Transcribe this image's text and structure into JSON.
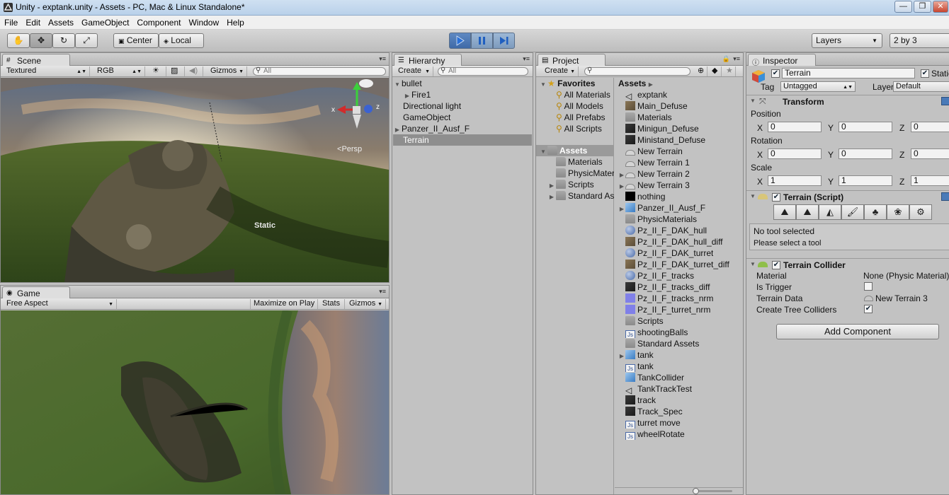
{
  "window": {
    "title": "Unity - exptank.unity - Assets - PC, Mac & Linux Standalone*"
  },
  "menu": [
    "File",
    "Edit",
    "Assets",
    "GameObject",
    "Component",
    "Window",
    "Help"
  ],
  "toolbar": {
    "pivot_label": "Center",
    "space_label": "Local",
    "layers_label": "Layers",
    "layout_label": "2 by 3"
  },
  "scene": {
    "tab": "Scene",
    "render_mode": "Textured",
    "color_mode": "RGB",
    "gizmos_label": "Gizmos",
    "search_placeholder": "All",
    "persp_label": "Persp",
    "static_label": "Static",
    "axis_x": "x",
    "axis_z": "z"
  },
  "game": {
    "tab": "Game",
    "aspect": "Free Aspect",
    "maximize_label": "Maximize on Play",
    "stats_label": "Stats",
    "gizmos_label": "Gizmos"
  },
  "hierarchy": {
    "tab": "Hierarchy",
    "create_label": "Create",
    "search_placeholder": "All",
    "items": [
      {
        "label": "bullet",
        "expanded": true,
        "depth": 0
      },
      {
        "label": "Fire1",
        "depth": 1,
        "has_children": true
      },
      {
        "label": "Directional light",
        "depth": 0
      },
      {
        "label": "GameObject",
        "depth": 0
      },
      {
        "label": "Panzer_II_Ausf_F",
        "depth": 0,
        "has_children": true
      },
      {
        "label": "Terrain",
        "depth": 0,
        "selected": true
      }
    ]
  },
  "project": {
    "tab": "Project",
    "create_label": "Create",
    "favorites_label": "Favorites",
    "favorites": [
      "All Materials",
      "All Models",
      "All Prefabs",
      "All Scripts"
    ],
    "tree_root": "Assets",
    "tree": [
      "Materials",
      "PhysicMaterials",
      "Scripts",
      "Standard Assets"
    ],
    "breadcrumb": "Assets",
    "assets": [
      {
        "name": "exptank",
        "kind": "unity"
      },
      {
        "name": "Main_Defuse",
        "kind": "texture"
      },
      {
        "name": "Materials",
        "kind": "folder"
      },
      {
        "name": "Minigun_Defuse",
        "kind": "texture-dark"
      },
      {
        "name": "Ministand_Defuse",
        "kind": "texture-dark"
      },
      {
        "name": "New Terrain",
        "kind": "terrain"
      },
      {
        "name": "New Terrain 1",
        "kind": "terrain"
      },
      {
        "name": "New Terrain 2",
        "kind": "terrain",
        "expandable": true
      },
      {
        "name": "New Terrain 3",
        "kind": "terrain",
        "expandable": true
      },
      {
        "name": "nothing",
        "kind": "black"
      },
      {
        "name": "Panzer_II_Ausf_F",
        "kind": "prefab",
        "expandable": true
      },
      {
        "name": "PhysicMaterials",
        "kind": "folder"
      },
      {
        "name": "Pz_II_F_DAK_hull",
        "kind": "sphere"
      },
      {
        "name": "Pz_II_F_DAK_hull_diff",
        "kind": "texture"
      },
      {
        "name": "Pz_II_F_DAK_turret",
        "kind": "sphere"
      },
      {
        "name": "Pz_II_F_DAK_turret_diff",
        "kind": "texture"
      },
      {
        "name": "Pz_II_F_tracks",
        "kind": "sphere"
      },
      {
        "name": "Pz_II_F_tracks_diff",
        "kind": "texture-dark"
      },
      {
        "name": "Pz_II_F_tracks_nrm",
        "kind": "normal"
      },
      {
        "name": "Pz_II_F_turret_nrm",
        "kind": "normal"
      },
      {
        "name": "Scripts",
        "kind": "folder"
      },
      {
        "name": "shootingBalls",
        "kind": "js"
      },
      {
        "name": "Standard Assets",
        "kind": "folder"
      },
      {
        "name": "tank",
        "kind": "prefab",
        "expandable": true
      },
      {
        "name": "tank",
        "kind": "js"
      },
      {
        "name": "TankCollider",
        "kind": "prefab"
      },
      {
        "name": "TankTrackTest",
        "kind": "unity"
      },
      {
        "name": "track",
        "kind": "texture-dark"
      },
      {
        "name": "Track_Spec",
        "kind": "texture-dark"
      },
      {
        "name": "turret move",
        "kind": "js"
      },
      {
        "name": "wheelRotate",
        "kind": "js"
      }
    ]
  },
  "inspector": {
    "tab": "Inspector",
    "object_name": "Terrain",
    "static_label": "Static",
    "tag_label": "Tag",
    "tag_value": "Untagged",
    "layer_label": "Layer",
    "layer_value": "Default",
    "transform": {
      "title": "Transform",
      "position_label": "Position",
      "rotation_label": "Rotation",
      "scale_label": "Scale",
      "x": "X",
      "y": "Y",
      "z": "Z",
      "position": [
        "0",
        "0",
        "0"
      ],
      "rotation": [
        "0",
        "0",
        "0"
      ],
      "scale": [
        "1",
        "1",
        "1"
      ]
    },
    "terrain_script": {
      "title": "Terrain (Script)",
      "tool_status": "No tool selected",
      "tool_hint": "Please select a tool"
    },
    "terrain_collider": {
      "title": "Terrain Collider",
      "material_label": "Material",
      "material_value": "None (Physic Material)",
      "is_trigger_label": "Is Trigger",
      "terrain_data_label": "Terrain Data",
      "terrain_data_value": "New Terrain 3",
      "create_tree_label": "Create Tree Colliders"
    },
    "add_component_label": "Add Component"
  },
  "colors": {
    "panel_bg": "#c2c2c2",
    "selection": "#8e8e8e",
    "play_active": "#3f6aa8"
  }
}
